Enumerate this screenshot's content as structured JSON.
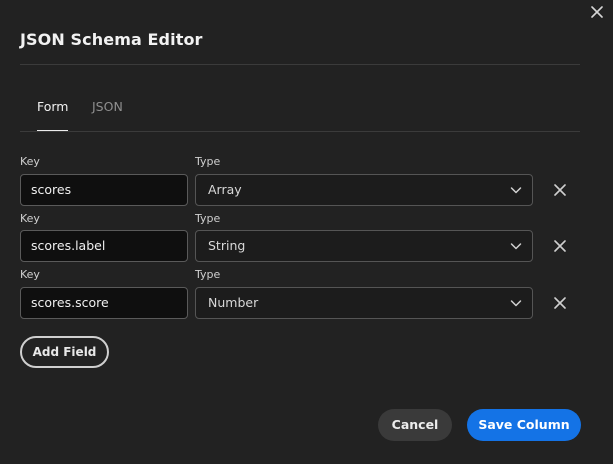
{
  "dialog": {
    "title": "JSON Schema Editor"
  },
  "tabs": [
    {
      "label": "Form",
      "active": true
    },
    {
      "label": "JSON",
      "active": false
    }
  ],
  "fields": {
    "key_label": "Key",
    "type_label": "Type",
    "rows": [
      {
        "key": "scores",
        "type": "Array"
      },
      {
        "key": "scores.label",
        "type": "String"
      },
      {
        "key": "scores.score",
        "type": "Number"
      }
    ]
  },
  "actions": {
    "add_field": "Add Field",
    "cancel": "Cancel",
    "save": "Save Column"
  },
  "colors": {
    "background": "#222222",
    "primary": "#1473e6",
    "secondary_button": "#3a3a3a"
  },
  "icons": {
    "close": "close-icon",
    "chevron": "chevron-down-icon",
    "remove": "remove-icon"
  }
}
